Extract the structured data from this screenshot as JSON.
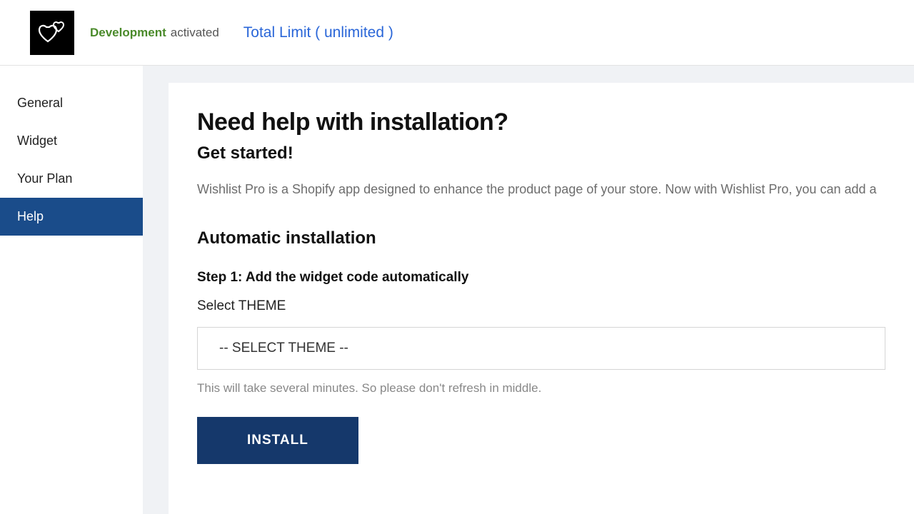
{
  "header": {
    "status_dev": "Development",
    "status_act": "activated",
    "limit_link": "Total Limit ( unlimited )"
  },
  "sidebar": {
    "items": [
      {
        "label": "General",
        "active": false
      },
      {
        "label": "Widget",
        "active": false
      },
      {
        "label": "Your Plan",
        "active": false
      },
      {
        "label": "Help",
        "active": true
      }
    ]
  },
  "main": {
    "title": "Need help with installation?",
    "subtitle": "Get started!",
    "description": "Wishlist Pro is a Shopify app designed to enhance the product page of your store. Now with Wishlist Pro, you can add a ",
    "auto_heading": "Automatic installation",
    "step1": "Step 1: Add the widget code automatically",
    "select_label": "Select THEME",
    "select_placeholder": "-- SELECT THEME --",
    "note": "This will take several minutes. So please don't refresh in middle.",
    "install_btn": "INSTALL"
  }
}
